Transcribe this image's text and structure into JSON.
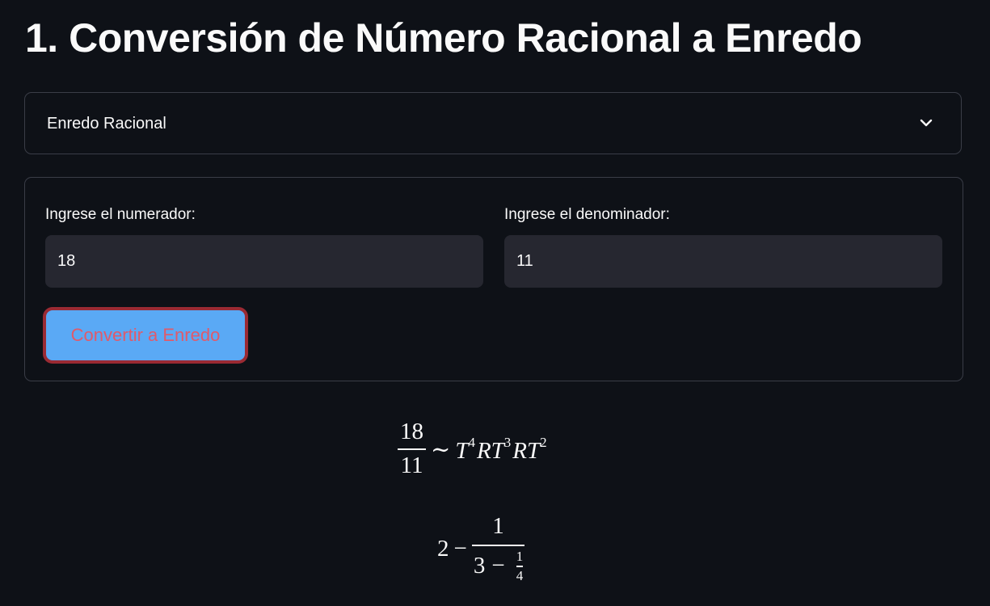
{
  "page": {
    "title": "1. Conversión de Número Racional a Enredo"
  },
  "selector": {
    "selected": "Enredo Racional",
    "icon": "chevron-down-icon"
  },
  "form": {
    "numerator_label": "Ingrese el numerador:",
    "numerator_value": "18",
    "denominator_label": "Ingrese el denominador:",
    "denominator_value": "11",
    "submit_label": "Convertir a Enredo"
  },
  "result": {
    "fraction_numerator": "18",
    "fraction_denominator": "11",
    "relation": "∼",
    "tangle": [
      {
        "op": "T",
        "exp": "4"
      },
      {
        "op": "RT",
        "exp": "3"
      },
      {
        "op": "RT",
        "exp": "2"
      }
    ],
    "continued_fraction": {
      "a0": "2",
      "minus": "−",
      "numer": "1",
      "a1": "3",
      "inner_numer": "1",
      "inner_denom": "4"
    }
  },
  "colors": {
    "background": "#0e1117",
    "input_bg": "#262730",
    "button_bg": "#5aa9f5",
    "button_border": "#9a2a33",
    "button_text": "#e05a6a"
  }
}
